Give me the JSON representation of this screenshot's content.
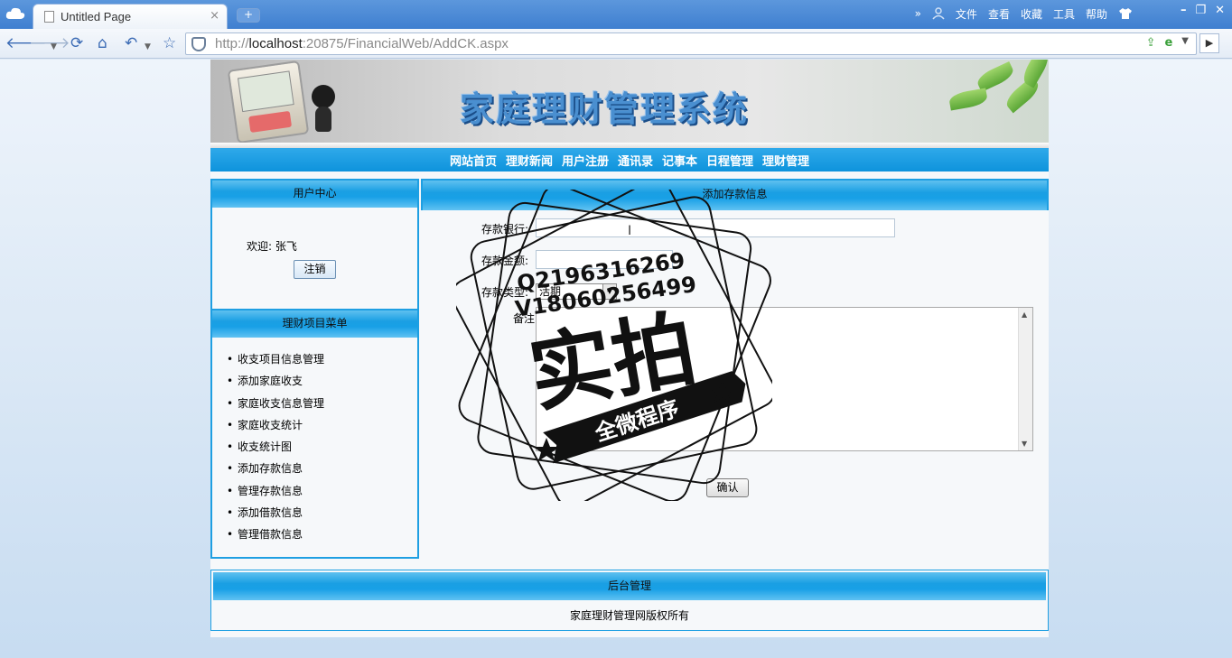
{
  "browser": {
    "tab_title": "Untitled Page",
    "tab_close": "×",
    "new_tab": "+",
    "menu": [
      "文件",
      "查看",
      "收藏",
      "工具",
      "帮助"
    ],
    "more": "»",
    "window_controls": [
      "–",
      "❐",
      "✕"
    ],
    "url_prefix": "http://",
    "url_host": "localhost",
    "url_rest": ":20875/FinancialWeb/AddCK.aspx",
    "go": "▶",
    "icons": [
      "back-icon",
      "forward-icon",
      "refresh-icon",
      "home-icon",
      "undo-icon",
      "favorite-star-icon"
    ]
  },
  "site": {
    "banner_title": "家庭理财管理系统",
    "nav": [
      "网站首页",
      "理财新闻",
      "用户注册",
      "通讯录",
      "记事本",
      "日程管理",
      "理财管理"
    ]
  },
  "user_center": {
    "title": "用户中心",
    "welcome": "欢迎: 张飞",
    "logout_label": "注销"
  },
  "menu": {
    "title": "理财项目菜单",
    "items": [
      "收支项目信息管理",
      "添加家庭收支",
      "家庭收支信息管理",
      "家庭收支统计",
      "收支统计图",
      "添加存款信息",
      "管理存款信息",
      "添加借款信息",
      "管理借款信息"
    ]
  },
  "form": {
    "title": "添加存款信息",
    "bank_label": "存款银行:",
    "bank_value": "",
    "amount_label": "存款金额:",
    "amount_value": "",
    "type_label": "存款类型:",
    "type_value": "活期",
    "note_label": "备注:",
    "note_value": "",
    "confirm_label": "确认"
  },
  "footer": {
    "title": "后台管理",
    "copyright": "家庭理财管理网版权所有"
  },
  "watermark": {
    "line1": "Q2196316269",
    "line2": "V18060256499",
    "big": "实拍",
    "ribbon": "全微程序"
  },
  "colors": {
    "accent_blue": "#1e9fe2",
    "chrome_blue": "#4a8ad6"
  }
}
